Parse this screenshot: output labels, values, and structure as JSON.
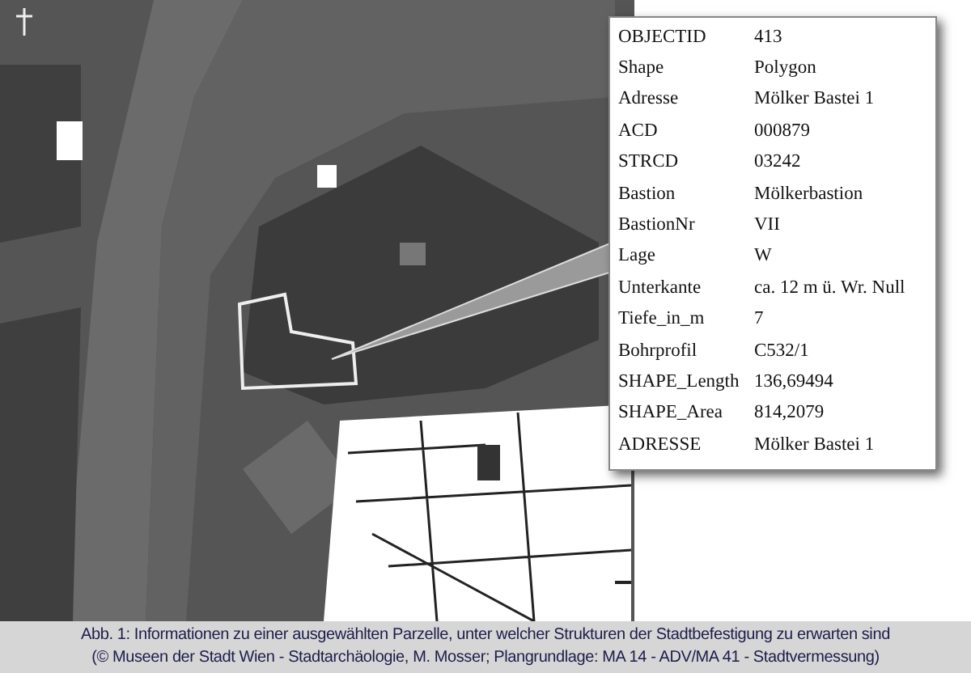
{
  "attribute_popup": {
    "rows": [
      {
        "field": "OBJECTID",
        "value": "413"
      },
      {
        "field": "Shape",
        "value": "Polygon"
      },
      {
        "field": "Adresse",
        "value": "Mölker Bastei 1"
      },
      {
        "field": "ACD",
        "value": "000879"
      },
      {
        "field": "STRCD",
        "value": "03242"
      },
      {
        "field": "Bastion",
        "value": "Mölkerbastion"
      },
      {
        "field": "BastionNr",
        "value": "VII"
      },
      {
        "field": "Lage",
        "value": "W"
      },
      {
        "field": "Unterkante",
        "value": "ca. 12 m ü. Wr. Null"
      },
      {
        "field": "Tiefe_in_m",
        "value": "7"
      },
      {
        "field": "Bohrprofil",
        "value": "C532/1"
      },
      {
        "field": "SHAPE_Length",
        "value": "136,69494"
      },
      {
        "field": "SHAPE_Area",
        "value": "814,2079"
      },
      {
        "field": "ADRESSE",
        "value": "Mölker Bastei 1"
      }
    ]
  },
  "caption": {
    "lines": [
      "Abb. 1: Informationen zu einer ausgewählten Parzelle, unter welcher Strukturen der Stadtbefestigung zu erwarten sind",
      "(© Museen der Stadt Wien - Stadtarchäologie, M. Mosser; Plangrundlage: MA 14 - ADV/MA 41 - Stadtvermessung)"
    ]
  }
}
